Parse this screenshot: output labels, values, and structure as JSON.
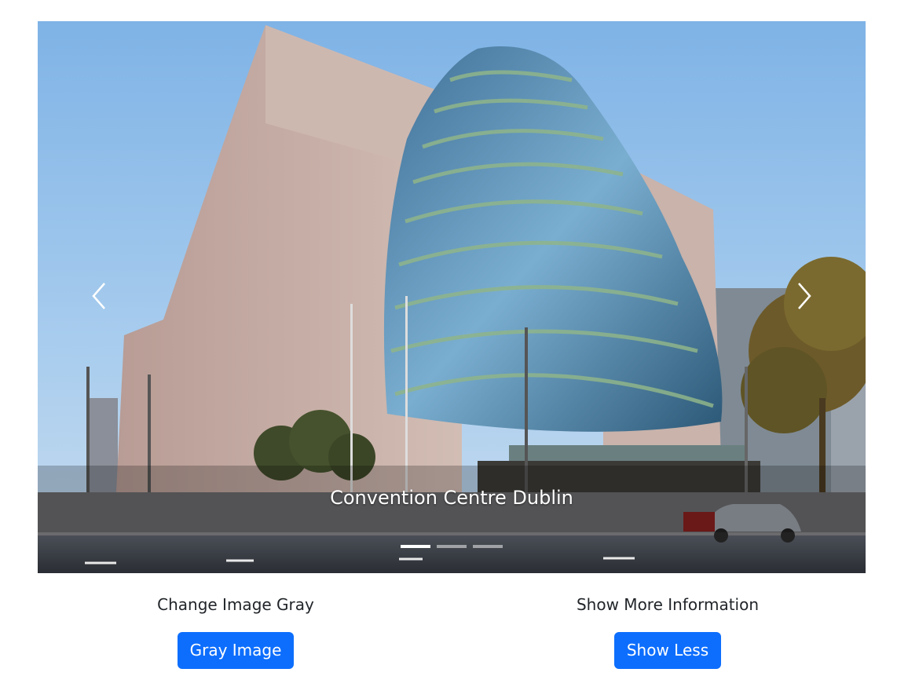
{
  "carousel": {
    "caption": "Convention Centre Dublin",
    "prev_icon": "chevron-left-icon",
    "next_icon": "chevron-right-icon",
    "slide_count": 3,
    "active_slide": 1
  },
  "left_section": {
    "title": "Change Image Gray",
    "button_label": "Gray Image"
  },
  "right_section": {
    "title": "Show More Information",
    "button_label": "Show Less"
  },
  "colors": {
    "button_primary": "#0d6efd",
    "text": "#212529"
  }
}
